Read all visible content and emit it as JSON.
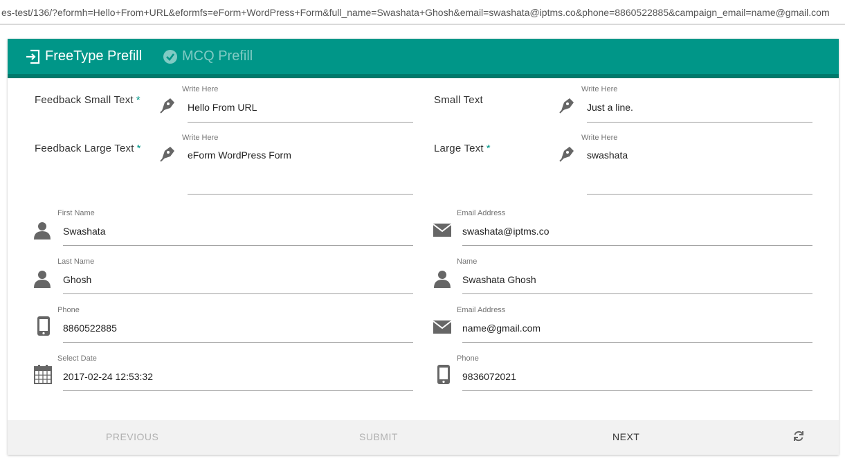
{
  "browser": {
    "url": "es-test/136/?eformh=Hello+From+URL&eformfs=eForm+WordPress+Form&full_name=Swashata+Ghosh&email=swashata@iptms.co&phone=8860522885&campaign_email=name@gmail.com"
  },
  "tabs": [
    {
      "label": "FreeType Prefill",
      "icon": "sign-in-icon",
      "active": true
    },
    {
      "label": "MCQ Prefill",
      "icon": "check-circle-icon",
      "active": false
    }
  ],
  "freetype": {
    "feedback_small": {
      "label": "Feedback Small Text",
      "required": "*",
      "hint": "Write Here",
      "value": "Hello From URL",
      "icon": "pen-icon"
    },
    "small": {
      "label": "Small Text",
      "hint": "Write Here",
      "value": "Just a line.",
      "icon": "pen-icon"
    },
    "feedback_large": {
      "label": "Feedback Large Text",
      "required": "*",
      "hint": "Write Here",
      "value": "eForm WordPress Form",
      "icon": "pen-icon"
    },
    "large": {
      "label": "Large Text",
      "required": "*",
      "hint": "Write Here",
      "value": "swashata",
      "icon": "pen-icon"
    }
  },
  "left_fields": [
    {
      "hint": "First Name",
      "value": "Swashata",
      "icon": "user-icon"
    },
    {
      "hint": "Last Name",
      "value": "Ghosh",
      "icon": "user-icon"
    },
    {
      "hint": "Phone",
      "value": "8860522885",
      "icon": "mobile-icon"
    },
    {
      "hint": "Select Date",
      "value": "2017-02-24 12:53:32",
      "icon": "calendar-icon"
    }
  ],
  "right_fields": [
    {
      "hint": "Email Address",
      "value": "swashata@iptms.co",
      "icon": "envelope-icon"
    },
    {
      "hint": "Name",
      "value": "Swashata Ghosh",
      "icon": "user-icon"
    },
    {
      "hint": "Email Address",
      "value": "name@gmail.com",
      "icon": "envelope-icon"
    },
    {
      "hint": "Phone",
      "value": "9836072021",
      "icon": "mobile-icon"
    }
  ],
  "footer": {
    "previous": "PREVIOUS",
    "submit": "SUBMIT",
    "next": "NEXT",
    "refresh_icon": "refresh-icon"
  },
  "colors": {
    "primary": "#009688",
    "primary_dark": "#00796b",
    "tab_inactive": "#80cbc4",
    "icon": "#666666"
  }
}
